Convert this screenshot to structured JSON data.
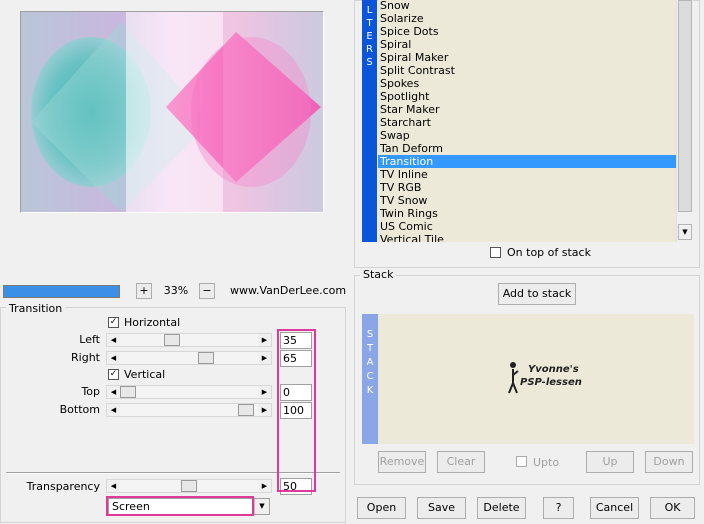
{
  "preview": {
    "zoom": "33%",
    "plus_label": "+",
    "minus_label": "−",
    "website": "www.VanDerLee.com"
  },
  "filters": {
    "vertical_label": [
      "L",
      "T",
      "E",
      "R",
      "S"
    ],
    "items": [
      "Snow",
      "Solarize",
      "Spice Dots",
      "Spiral",
      "Spiral Maker",
      "Split Contrast",
      "Spokes",
      "Spotlight",
      "Star Maker",
      "Starchart",
      "Swap",
      "Tan Deform",
      "Transition",
      "TV Inline",
      "TV RGB",
      "TV Snow",
      "Twin Rings",
      "US Comic",
      "Vertical Tile"
    ],
    "selected": "Transition",
    "on_top_label": "On top of stack"
  },
  "transition": {
    "title": "Transition",
    "horizontal_label": "Horizontal",
    "horizontal_checked": true,
    "left_label": "Left",
    "left_value": "35",
    "right_label": "Right",
    "right_value": "65",
    "vertical_label": "Vertical",
    "vertical_checked": true,
    "top_label": "Top",
    "top_value": "0",
    "bottom_label": "Bottom",
    "bottom_value": "100",
    "transparency_label": "Transparency",
    "transparency_value": "50",
    "blend_mode": "Screen"
  },
  "stack": {
    "title": "Stack",
    "add_label": "Add to stack",
    "vertical_label": [
      "S",
      "T",
      "A",
      "C",
      "K"
    ],
    "watermark_line1": "Yvonne's",
    "watermark_line2": "PSP-lessen",
    "remove_label": "Remove",
    "clear_label": "Clear",
    "upto_label": "Upto",
    "up_label": "Up",
    "down_label": "Down"
  },
  "footer": {
    "open_label": "Open",
    "save_label": "Save",
    "delete_label": "Delete",
    "help_label": "?",
    "cancel_label": "Cancel",
    "ok_label": "OK"
  },
  "colors": {
    "highlight": "#e0399a",
    "selection": "#3399ff",
    "stack_bar": "#8aa6e6",
    "filter_bar": "#0a55d8",
    "progress": "#3c8fe6"
  }
}
